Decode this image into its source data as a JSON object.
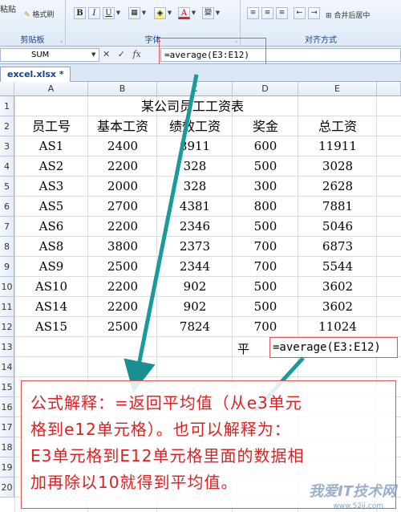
{
  "ribbon": {
    "clipboard": {
      "paste": "粘贴",
      "format_painter": "格式刷",
      "label": "剪贴板"
    },
    "font": {
      "bold": "B",
      "italic": "I",
      "underline": "U",
      "font_color": "A",
      "phonetic": "變",
      "label": "字体"
    },
    "alignment": {
      "merge_center": "合并后居中",
      "label": "对齐方式"
    }
  },
  "formula_bar": {
    "name_box": "SUM",
    "formula": "=average(E3:E12)",
    "fx": "fx"
  },
  "tabs": [
    {
      "label": "excel.xlsx *"
    }
  ],
  "columns": [
    "A",
    "B",
    "C",
    "D",
    "E"
  ],
  "rows": [
    "1",
    "2",
    "3",
    "4",
    "5",
    "6",
    "7",
    "8",
    "9",
    "10",
    "11",
    "12",
    "13",
    "14",
    "15",
    "16",
    "17",
    "18",
    "19",
    "20"
  ],
  "sheet": {
    "title": "某公司员工工资表",
    "headers": [
      "员工号",
      "基本工资",
      "绩效工资",
      "奖金",
      "总工资"
    ],
    "data": [
      [
        "AS1",
        "2400",
        "8911",
        "600",
        "11911"
      ],
      [
        "AS2",
        "2200",
        "328",
        "500",
        "3028"
      ],
      [
        "AS3",
        "2000",
        "328",
        "300",
        "2628"
      ],
      [
        "AS5",
        "2700",
        "4381",
        "800",
        "7881"
      ],
      [
        "AS6",
        "2200",
        "2346",
        "500",
        "5046"
      ],
      [
        "AS8",
        "3800",
        "2373",
        "700",
        "6873"
      ],
      [
        "AS9",
        "2500",
        "2344",
        "700",
        "5544"
      ],
      [
        "AS10",
        "2200",
        "902",
        "500",
        "3602"
      ],
      [
        "AS14",
        "2200",
        "902",
        "500",
        "3602"
      ],
      [
        "AS15",
        "2500",
        "7824",
        "700",
        "11024"
      ]
    ],
    "avg_label": "平",
    "avg_formula": "=average(E3:E12)"
  },
  "annotation": {
    "line1": "公式解释：=返回平均值（从e3单元",
    "line2": "格到e12单元格）。也可以解释为：",
    "line3": "E3单元格到E12单元格里面的数据相",
    "line4": "加再除以10就得到平均值。"
  },
  "watermark": {
    "main": "我爱IT技术网",
    "sub": "www.52ij.com"
  }
}
